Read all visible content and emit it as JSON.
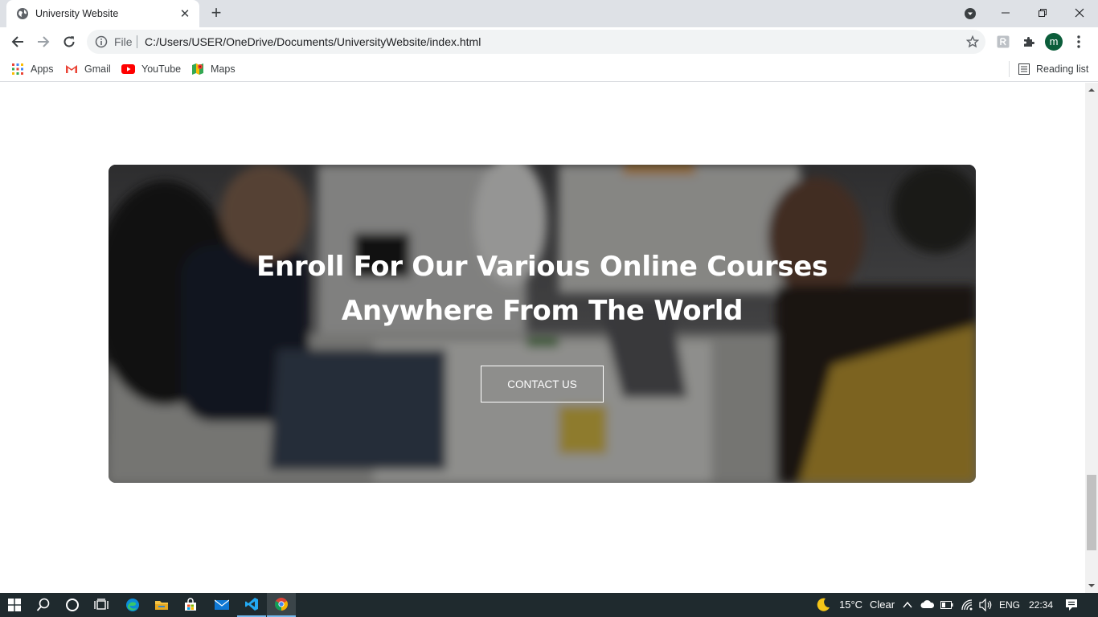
{
  "browser": {
    "tab_title": "University Website",
    "new_tab_symbol": "+",
    "address_scheme": "File",
    "address_url": "C:/Users/USER/OneDrive/Documents/UniversityWebsite/index.html",
    "profile_initial": "m",
    "bookmarks": [
      {
        "label": "Apps",
        "icon": "apps-grid-icon"
      },
      {
        "label": "Gmail",
        "icon": "gmail-icon"
      },
      {
        "label": "YouTube",
        "icon": "youtube-icon"
      },
      {
        "label": "Maps",
        "icon": "maps-icon"
      }
    ],
    "reading_list_label": "Reading list"
  },
  "page": {
    "banner": {
      "heading_line1": "Enroll For Our Various Online Courses",
      "heading_line2": "Anywhere From The World",
      "button_label": "CONTACT US"
    }
  },
  "taskbar": {
    "weather_temp": "15°C",
    "weather_condition": "Clear",
    "language": "ENG",
    "time": "22:34"
  },
  "colors": {
    "tabstrip": "#dee1e6",
    "taskbar": "#1f2a2e",
    "avatar": "#0b5d3a"
  }
}
